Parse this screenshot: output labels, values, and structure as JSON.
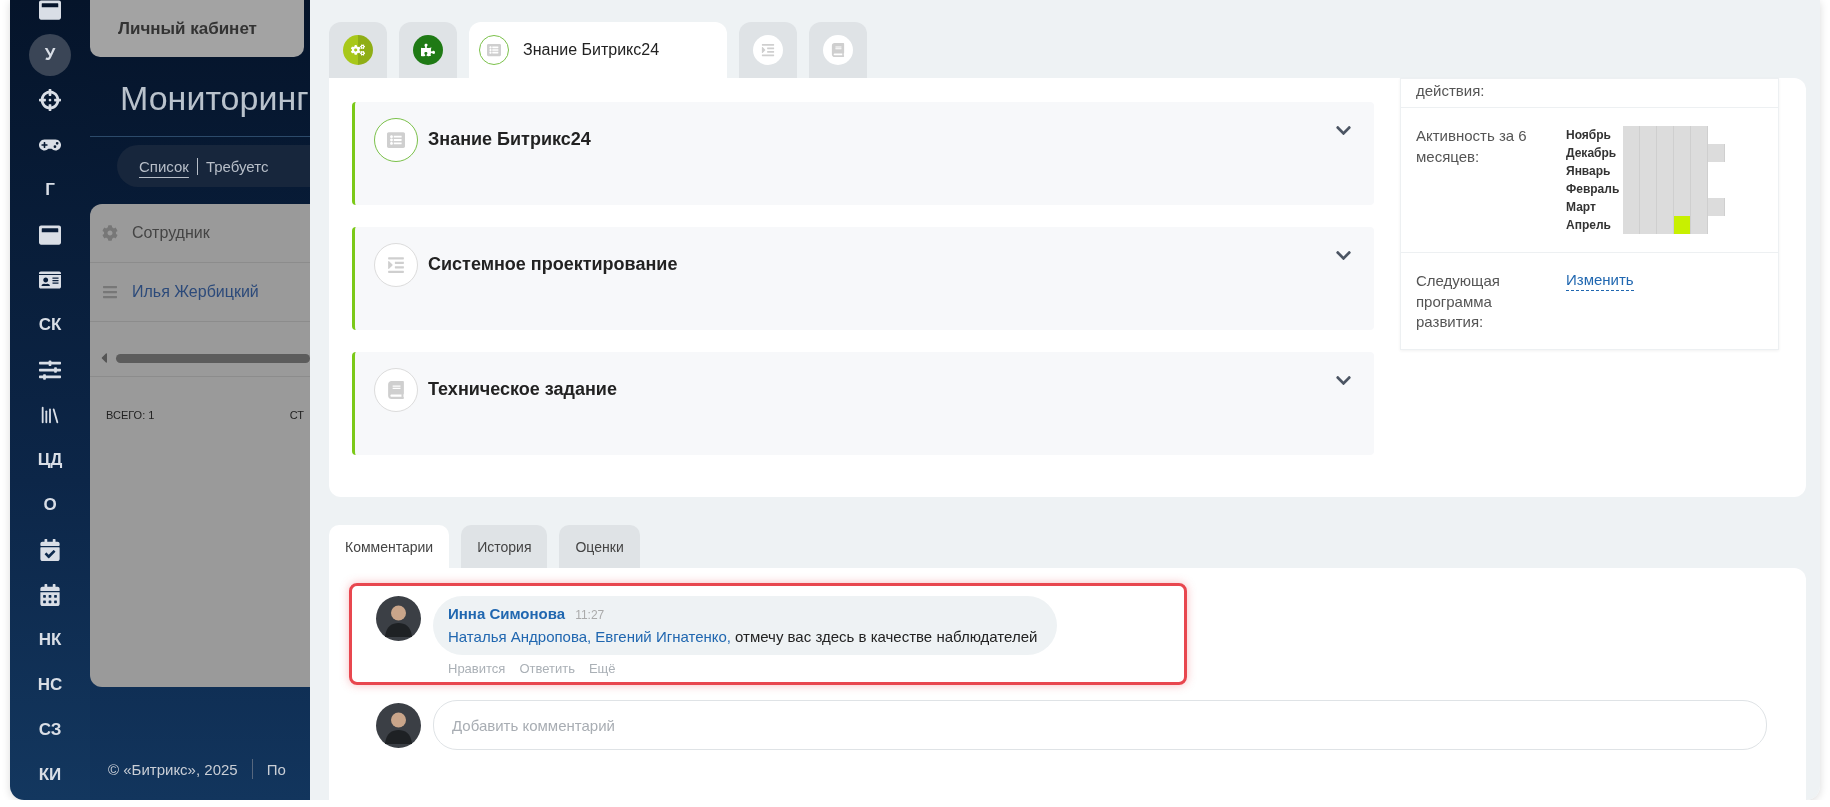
{
  "sidebar": {
    "items": [
      {
        "kind": "icon",
        "selected": false
      },
      {
        "kind": "letter",
        "label": "У",
        "selected": true
      },
      {
        "kind": "icon",
        "selected": false
      },
      {
        "kind": "icon",
        "selected": false
      },
      {
        "kind": "letter",
        "label": "Г",
        "selected": false
      },
      {
        "kind": "icon",
        "selected": false
      },
      {
        "kind": "icon",
        "selected": false
      },
      {
        "kind": "letter",
        "label": "СК",
        "selected": false
      },
      {
        "kind": "icon",
        "selected": false
      },
      {
        "kind": "icon",
        "selected": false
      },
      {
        "kind": "letter",
        "label": "ЦД",
        "selected": false
      },
      {
        "kind": "letter",
        "label": "О",
        "selected": false
      },
      {
        "kind": "icon",
        "selected": false
      },
      {
        "kind": "icon",
        "selected": false
      },
      {
        "kind": "letter",
        "label": "НК",
        "selected": false
      },
      {
        "kind": "letter",
        "label": "НС",
        "selected": false
      },
      {
        "kind": "letter",
        "label": "СЗ",
        "selected": false
      },
      {
        "kind": "letter",
        "label": "КИ",
        "selected": false
      }
    ]
  },
  "background_page": {
    "header_card": "Личный кабинет",
    "title": "Мониторинг",
    "filters": [
      {
        "label": "Список",
        "selected": true
      },
      {
        "label": "Требуетс",
        "selected": false
      }
    ],
    "table": {
      "header": "Сотрудник",
      "row": "Илья Жербицкий",
      "total": "ВСЕГО: 1",
      "column_2": "СТ"
    },
    "footer": {
      "copyright": "© «Битрикс», 2025",
      "link": "По"
    }
  },
  "panel": {
    "tabs": [
      {
        "selected": false
      },
      {
        "selected": false
      },
      {
        "label": "Знание Битрикс24",
        "selected": true
      },
      {
        "selected": false
      },
      {
        "selected": false
      }
    ],
    "sections": [
      {
        "title": "Знание Битрикс24",
        "active": true,
        "expanded": false
      },
      {
        "title": "Системное проектирование",
        "active": false,
        "expanded": false
      },
      {
        "title": "Техническое задание",
        "active": false,
        "expanded": false
      }
    ],
    "info": {
      "cut_label": "действия:",
      "activity": {
        "label": "Активность за 6 месяцев:",
        "months": [
          {
            "label": "Ноябрь",
            "cells": [
              false,
              false,
              false,
              false,
              false
            ]
          },
          {
            "label": "Декабрь",
            "cells": [
              false,
              false,
              false,
              false,
              false,
              false
            ]
          },
          {
            "label": "Январь",
            "cells": [
              false,
              false,
              false,
              false,
              false
            ]
          },
          {
            "label": "Февраль",
            "cells": [
              false,
              false,
              false,
              false,
              false
            ]
          },
          {
            "label": "Март",
            "cells": [
              false,
              false,
              false,
              false,
              false,
              false
            ]
          },
          {
            "label": "Апрель",
            "cells": [
              false,
              false,
              false,
              true,
              false
            ]
          }
        ]
      },
      "next_program": {
        "label": "Следующая программа развития:",
        "link": "Изменить"
      }
    }
  },
  "comments": {
    "tabs": [
      {
        "label": "Комментарии",
        "selected": true
      },
      {
        "label": "История",
        "selected": false
      },
      {
        "label": "Оценки",
        "selected": false
      }
    ],
    "items": [
      {
        "author": "Инна Симонова",
        "time": "11:27",
        "mentions": [
          "Наталья Андропова,",
          "Евгений Игнатенко,"
        ],
        "text": "отмечу вас здесь в качестве наблюдателей",
        "highlighted": true,
        "actions": [
          "Нравится",
          "Ответить",
          "Ещё"
        ]
      }
    ],
    "input": {
      "placeholder": "Добавить комментарий"
    }
  }
}
